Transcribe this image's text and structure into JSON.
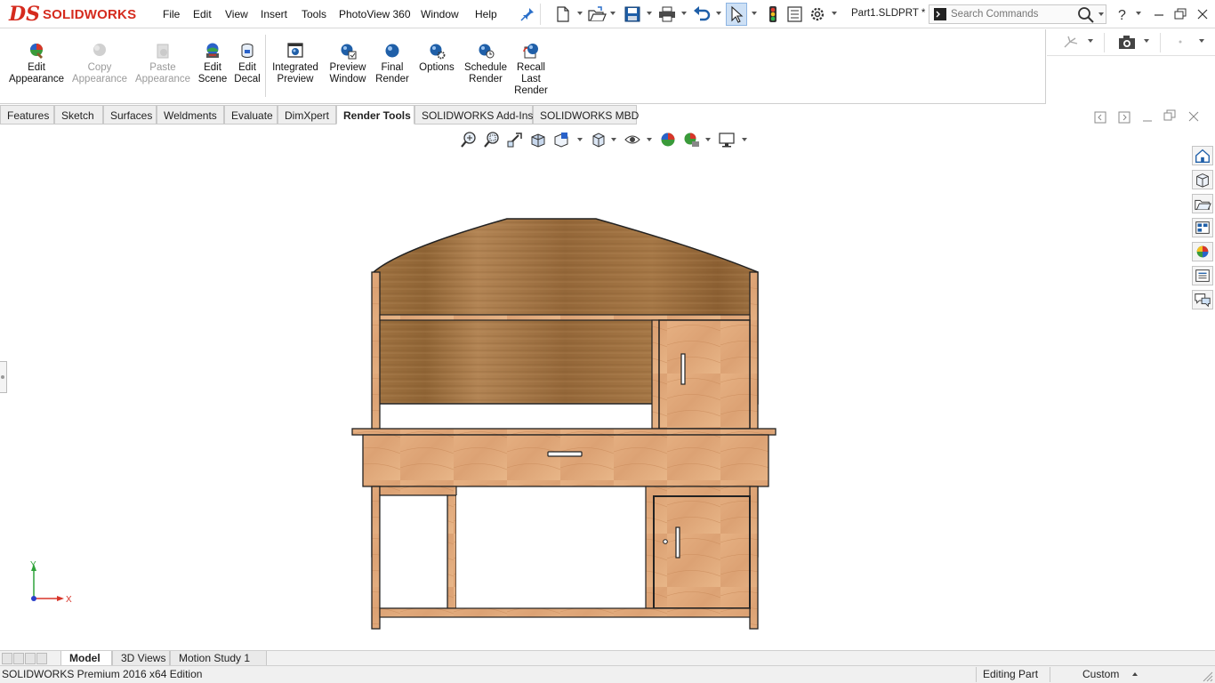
{
  "app": {
    "brand_ds": "DS",
    "brand_name": "SOLIDWORKS",
    "document_title": "Part1.SLDPRT *"
  },
  "menu": [
    "File",
    "Edit",
    "View",
    "Insert",
    "Tools",
    "PhotoView 360",
    "Window",
    "Help"
  ],
  "search": {
    "placeholder": "Search Commands"
  },
  "ribbon": {
    "buttons": [
      {
        "line1": "Edit",
        "line2": "Appearance",
        "line3": "",
        "enabled": true,
        "icon": "edit-appearance-icon"
      },
      {
        "line1": "Copy",
        "line2": "Appearance",
        "line3": "",
        "enabled": false,
        "icon": "copy-appearance-icon"
      },
      {
        "line1": "Paste",
        "line2": "Appearance",
        "line3": "",
        "enabled": false,
        "icon": "paste-appearance-icon"
      },
      {
        "line1": "Edit",
        "line2": "Scene",
        "line3": "",
        "enabled": true,
        "icon": "edit-scene-icon"
      },
      {
        "line1": "Edit",
        "line2": "Decal",
        "line3": "",
        "enabled": true,
        "icon": "edit-decal-icon"
      },
      {
        "line1": "Integrated",
        "line2": "Preview",
        "line3": "",
        "enabled": true,
        "icon": "integrated-preview-icon"
      },
      {
        "line1": "Preview",
        "line2": "Window",
        "line3": "",
        "enabled": true,
        "icon": "preview-window-icon"
      },
      {
        "line1": "Final",
        "line2": "Render",
        "line3": "",
        "enabled": true,
        "icon": "final-render-icon"
      },
      {
        "line1": "Options",
        "line2": "",
        "line3": "",
        "enabled": true,
        "icon": "options-icon"
      },
      {
        "line1": "Schedule",
        "line2": "Render",
        "line3": "",
        "enabled": true,
        "icon": "schedule-render-icon"
      },
      {
        "line1": "Recall",
        "line2": "Last",
        "line3": "Render",
        "enabled": true,
        "icon": "recall-last-render-icon"
      }
    ]
  },
  "tabs": [
    {
      "label": "Features",
      "active": false
    },
    {
      "label": "Sketch",
      "active": false
    },
    {
      "label": "Surfaces",
      "active": false
    },
    {
      "label": "Weldments",
      "active": false
    },
    {
      "label": "Evaluate",
      "active": false
    },
    {
      "label": "DimXpert",
      "active": false
    },
    {
      "label": "Render Tools",
      "active": true
    },
    {
      "label": "SOLIDWORKS Add-Ins",
      "active": false
    },
    {
      "label": "SOLIDWORKS MBD",
      "active": false
    }
  ],
  "triad": {
    "y_label": "Y",
    "x_label": "X"
  },
  "bottom_tabs": [
    {
      "label": "Model",
      "active": true
    },
    {
      "label": "3D Views",
      "active": false
    },
    {
      "label": "Motion Study 1",
      "active": false
    }
  ],
  "status": {
    "edition": "SOLIDWORKS Premium 2016 x64 Edition",
    "mode": "Editing Part",
    "units": "Custom"
  },
  "colors": {
    "brand_red": "#d52b1e",
    "wood_light": "#e1a779",
    "wood_dark": "#9a6a3a"
  }
}
